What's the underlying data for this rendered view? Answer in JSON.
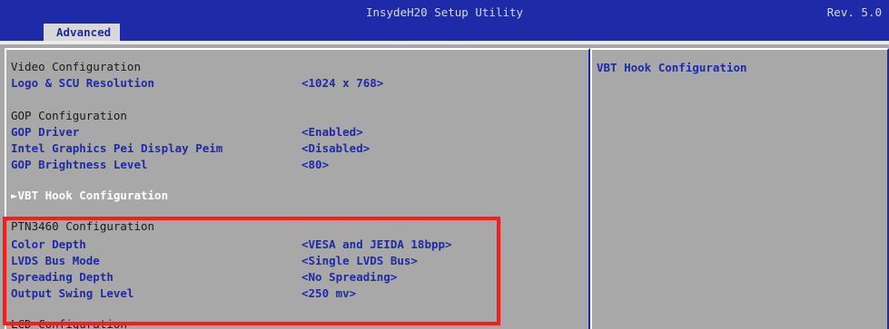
{
  "title": "InsydeH20 Setup Utility",
  "revision": "Rev. 5.0",
  "tabs": [
    {
      "label": "Advanced",
      "active": true
    }
  ],
  "colors": {
    "blue": "#1f2aa8",
    "panel_gray": "#a8a8a8",
    "highlight_red": "#ff1a1a"
  },
  "main": {
    "video_heading": "Video Configuration",
    "logo_resolution": {
      "label": "Logo & SCU Resolution",
      "value": "<1024 x 768>"
    },
    "gop_heading": "GOP Configuration",
    "gop_driver": {
      "label": "GOP Driver",
      "value": "<Enabled>"
    },
    "intel_peim": {
      "label": "Intel Graphics Pei Display Peim",
      "value": "<Disabled>"
    },
    "gop_brightness": {
      "label": "GOP Brightness Level",
      "value": "<80>"
    },
    "vbt_hook": {
      "label": "VBT Hook Configuration"
    },
    "ptn_heading": "PTN3460 Configuration",
    "color_depth": {
      "label": "Color Depth",
      "value": "<VESA and JEIDA 18bpp>"
    },
    "lvds_bus_mode": {
      "label": "LVDS Bus Mode",
      "value": "<Single LVDS Bus>"
    },
    "spreading_depth": {
      "label": "Spreading Depth",
      "value": "<No Spreading>"
    },
    "output_swing": {
      "label": "Output Swing Level",
      "value": "<250 mv>"
    },
    "lcd_heading": "LCD Configuration"
  },
  "help": {
    "text": "VBT Hook Configuration"
  }
}
